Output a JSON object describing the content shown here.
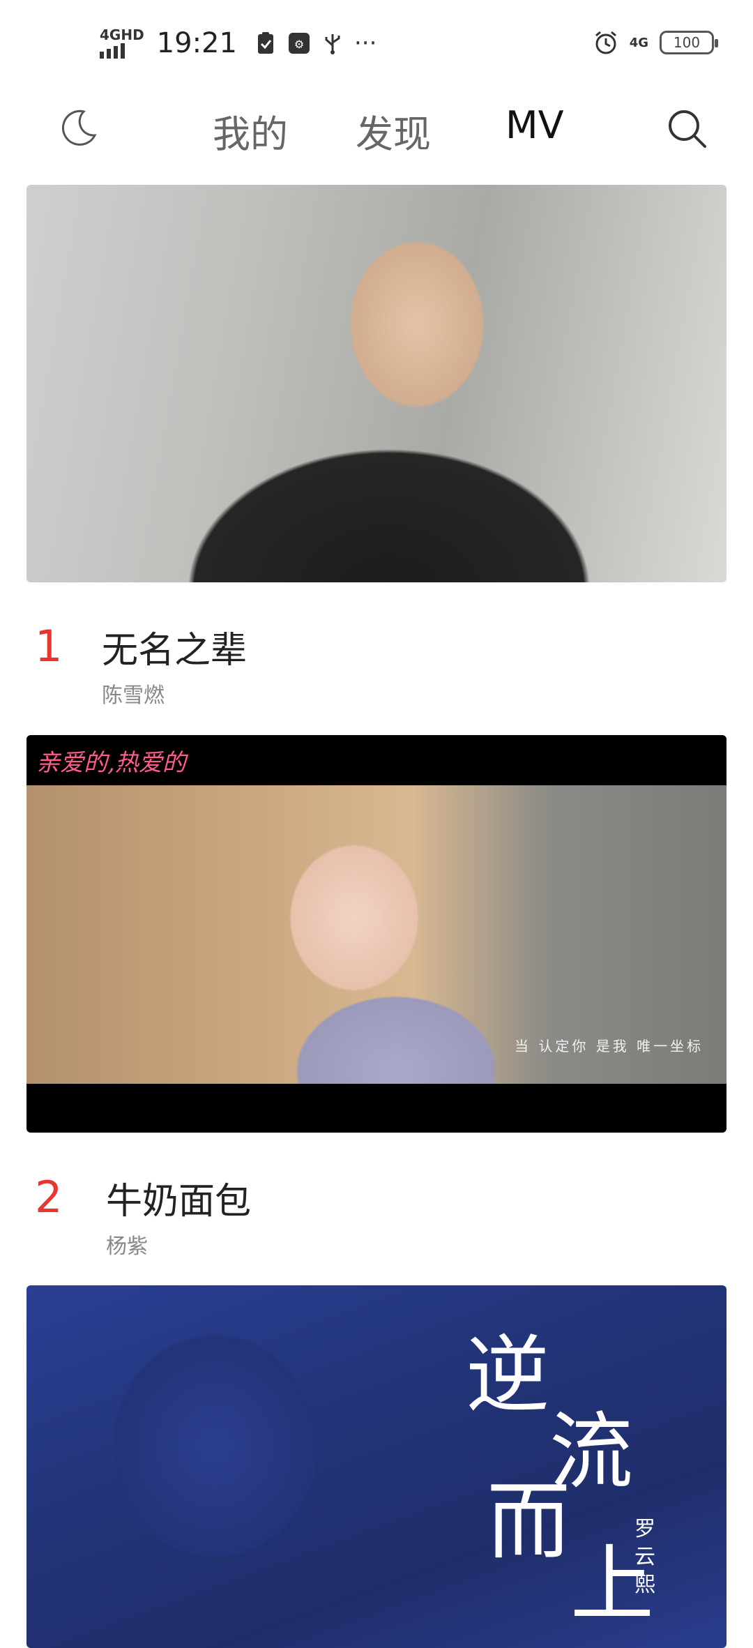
{
  "status_bar": {
    "network_top": "4GHD",
    "time": "19:21",
    "more": "···",
    "network_right": "4G",
    "battery": "100"
  },
  "nav": {
    "tabs": [
      {
        "label": "我的"
      },
      {
        "label": "发现"
      },
      {
        "label": "MV"
      }
    ],
    "active_tab": "MV"
  },
  "mv_list": [
    {
      "rank": "1",
      "title": "无名之辈",
      "artist": "陈雪燃"
    },
    {
      "rank": "2",
      "title": "牛奶面包",
      "artist": "杨紫",
      "thumb_title": "亲爱的,热爱的",
      "thumb_subtitle": "当 认定你 是我 唯一坐标"
    },
    {
      "thumb_title_chars": [
        "逆",
        "流",
        "而",
        "上"
      ],
      "thumb_artist": "罗云熙"
    }
  ],
  "colors": {
    "rank": "#e8352f",
    "active_tab": "#111111",
    "inactive_tab": "#666666",
    "artist_text": "#888888"
  }
}
